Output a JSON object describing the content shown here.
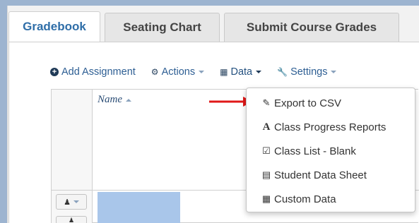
{
  "tabs": [
    {
      "label": "Gradebook",
      "active": true
    },
    {
      "label": "Seating Chart",
      "active": false
    },
    {
      "label": "Submit Course Grades",
      "active": false
    }
  ],
  "toolbar": {
    "add_assignment": "Add Assignment",
    "actions": "Actions",
    "data": "Data",
    "settings": "Settings"
  },
  "grid": {
    "name_header": "Name"
  },
  "data_menu": {
    "items": [
      {
        "label": "Export to CSV",
        "icon": "edit-export-icon"
      },
      {
        "label": "Class Progress Reports",
        "icon": "letter-a-icon"
      },
      {
        "label": "Class List - Blank",
        "icon": "checkbox-icon"
      },
      {
        "label": "Student Data Sheet",
        "icon": "list-icon"
      },
      {
        "label": "Custom Data",
        "icon": "table-icon"
      }
    ]
  },
  "colors": {
    "accent": "#2f6ea8",
    "arrow": "#e01818",
    "placeholder": "#a9c6ea"
  }
}
